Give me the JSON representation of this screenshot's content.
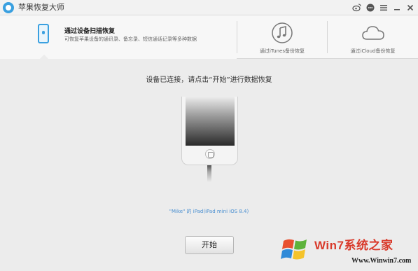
{
  "window": {
    "title": "苹果恢复大师"
  },
  "titlebar_icons": [
    "weibo-icon",
    "chat-icon",
    "menu-icon",
    "minimize-icon",
    "close-icon"
  ],
  "tabs": [
    {
      "title": "通过设备扫描恢复",
      "desc": "可恢复苹果设备的通讯录、备忘录、短信通话记录等多种数据",
      "icon": "iphone-icon",
      "active": true
    },
    {
      "label": "通过iTunes备份恢复",
      "icon": "music-note-icon",
      "active": false
    },
    {
      "label": "通过iCloud备份恢复",
      "icon": "cloud-icon",
      "active": false
    }
  ],
  "main": {
    "instruction": "设备已连接，请点击“开始”进行数据恢复",
    "device_name": "\"Mike\" 的 iPad(iPad mini iOS 8.4)",
    "start_button": "开始"
  },
  "watermark": {
    "line1": "Win7系统之家",
    "line2": "Www.Winwin7.com"
  },
  "colors": {
    "accent": "#3aa0e0",
    "device_text": "#4a8fd0",
    "watermark": "#d93a2b"
  }
}
